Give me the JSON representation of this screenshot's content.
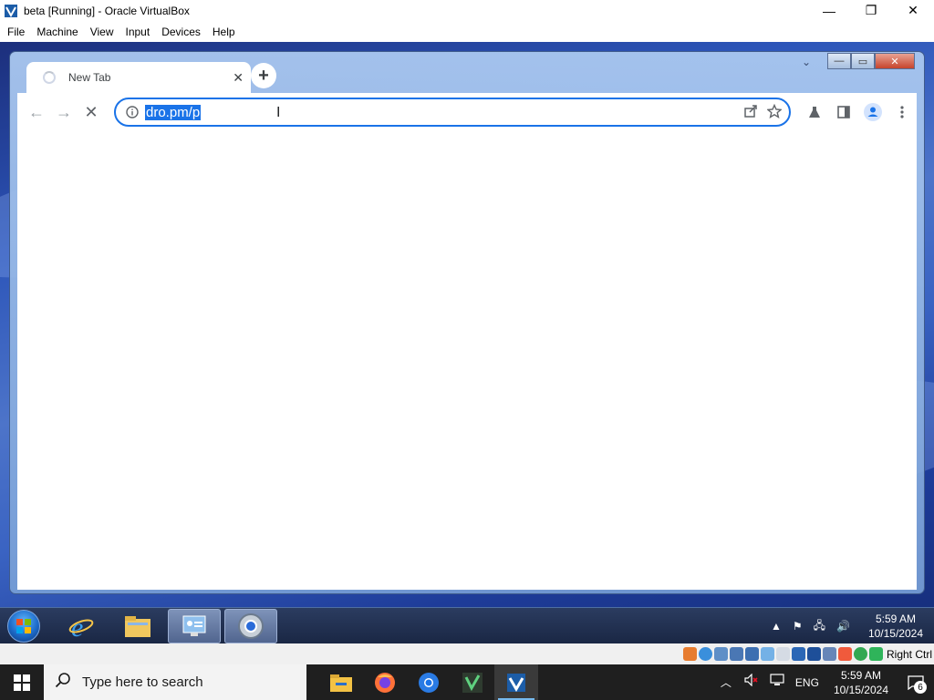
{
  "host_window": {
    "title": "beta [Running] - Oracle VirtualBox",
    "controls": {
      "minimize": "—",
      "restore": "❐",
      "close": "✕"
    },
    "menu": [
      "File",
      "Machine",
      "View",
      "Input",
      "Devices",
      "Help"
    ]
  },
  "browser": {
    "tab": {
      "title": "New Tab",
      "close": "✕",
      "loading": true
    },
    "new_tab_label": "+",
    "address": {
      "value": "dro.pm/p",
      "selected": true
    },
    "nav": {
      "back": "←",
      "forward": "→",
      "stop": "✕"
    },
    "window_controls": {
      "minimize": "—",
      "maximize": "▭",
      "close": "✕"
    }
  },
  "guest_taskbar": {
    "apps": [
      "internet-explorer",
      "windows-explorer",
      "control-panel",
      "chrome"
    ],
    "clock": {
      "time": "5:59 AM",
      "date": "10/15/2024"
    }
  },
  "vbox_status": {
    "host_key": "Right Ctrl",
    "icons": 13
  },
  "host_taskbar": {
    "search_placeholder": "Type here to search",
    "apps": [
      "file-explorer",
      "firefox",
      "chrome",
      "visual-studio",
      "virtualbox"
    ],
    "language": "ENG",
    "clock": {
      "time": "5:59 AM",
      "date": "10/15/2024"
    },
    "notification_count": "6"
  },
  "colors": {
    "accent": "#1a73e8",
    "guest_bg": "#2c55b9",
    "host_taskbar": "#1f1f1f"
  }
}
